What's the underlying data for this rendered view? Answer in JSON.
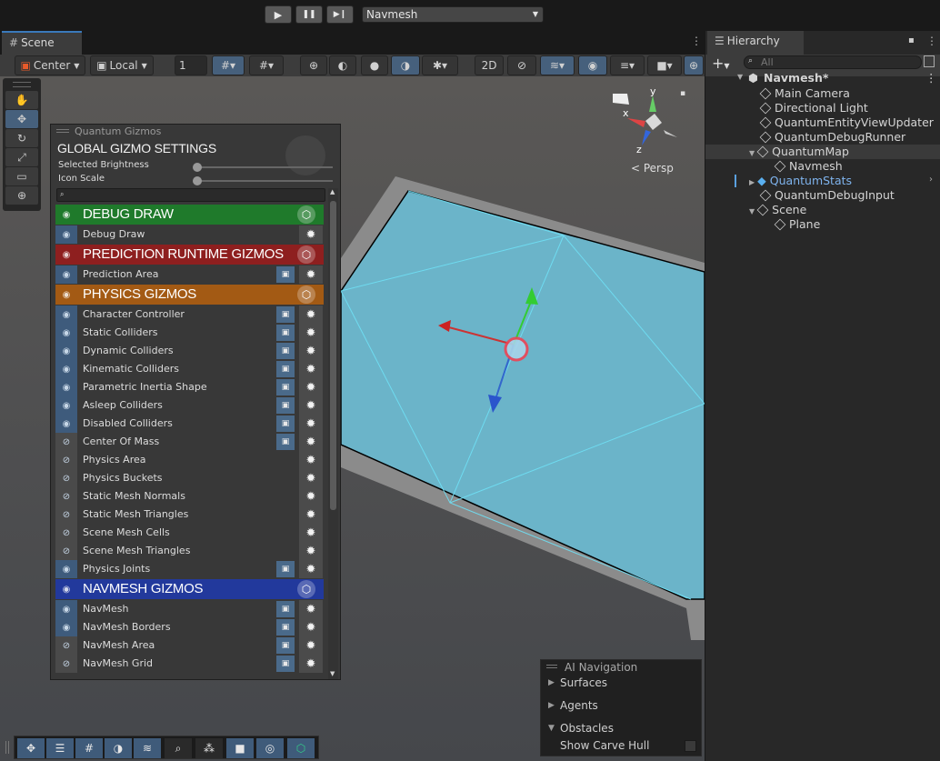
{
  "playbar": {
    "play_icon": "▶",
    "pause_icon": "❚❚",
    "step_icon": "▶❙",
    "scene_name": "Navmesh"
  },
  "scene_tab": {
    "label": "Scene",
    "icon": "#"
  },
  "scene_toolbar": {
    "pivot": "Center",
    "space": "Local",
    "grid_value": "1"
  },
  "tools": [
    "✋",
    "✥",
    "↻",
    "⤢",
    "▭",
    "⊕"
  ],
  "gizmo": {
    "y": "y",
    "x": "x",
    "z": "z",
    "persp": "< Persp",
    "lock": "🔒"
  },
  "quantum": {
    "title": "Quantum Gizmos",
    "heading": "GLOBAL GIZMO SETTINGS",
    "brightness_label": "Selected Brightness",
    "iconscale_label": "Icon Scale",
    "search_icon": "🔍",
    "sections": {
      "debug_draw": {
        "title": "DEBUG DRAW",
        "color": "#1f7a2b"
      },
      "prediction": {
        "title": "PREDICTION RUNTIME GIZMOS",
        "color": "#8e1f1f"
      },
      "physics": {
        "title": "PHYSICS GIZMOS",
        "color": "#a35a14"
      },
      "navmesh": {
        "title": "NAVMESH GIZMOS",
        "color": "#22399c"
      }
    },
    "rows": {
      "debug_draw": "Debug Draw",
      "prediction_area": "Prediction Area",
      "character_controller": "Character Controller",
      "static_colliders": "Static Colliders",
      "dynamic_colliders": "Dynamic Colliders",
      "kinematic_colliders": "Kinematic Colliders",
      "parametric_inertia": "Parametric Inertia Shape",
      "asleep_colliders": "Asleep Colliders",
      "disabled_colliders": "Disabled Colliders",
      "center_of_mass": "Center Of Mass",
      "physics_area": "Physics Area",
      "physics_buckets": "Physics Buckets",
      "static_mesh_normals": "Static Mesh Normals",
      "static_mesh_triangles": "Static Mesh Triangles",
      "scene_mesh_cells": "Scene Mesh Cells",
      "scene_mesh_triangles": "Scene Mesh Triangles",
      "physics_joints": "Physics Joints",
      "navmesh": "NavMesh",
      "navmesh_borders": "NavMesh Borders",
      "navmesh_area": "NavMesh Area",
      "navmesh_grid": "NavMesh Grid"
    }
  },
  "hierarchy": {
    "title": "Hierarchy",
    "search_placeholder": "All",
    "add_icon": "+",
    "scene": "Navmesh*",
    "items": {
      "main_camera": "Main Camera",
      "dir_light": "Directional Light",
      "entity_view": "QuantumEntityViewUpdater",
      "debug_runner": "QuantumDebugRunner",
      "quantum_map": "QuantumMap",
      "navmesh_child": "Navmesh",
      "quantum_stats": "QuantumStats",
      "debug_input": "QuantumDebugInput",
      "scene_obj": "Scene",
      "plane": "Plane"
    }
  },
  "ai_nav": {
    "title": "AI Navigation",
    "surfaces": "Surfaces",
    "agents": "Agents",
    "obstacles": "Obstacles",
    "carve": "Show Carve Hull"
  }
}
